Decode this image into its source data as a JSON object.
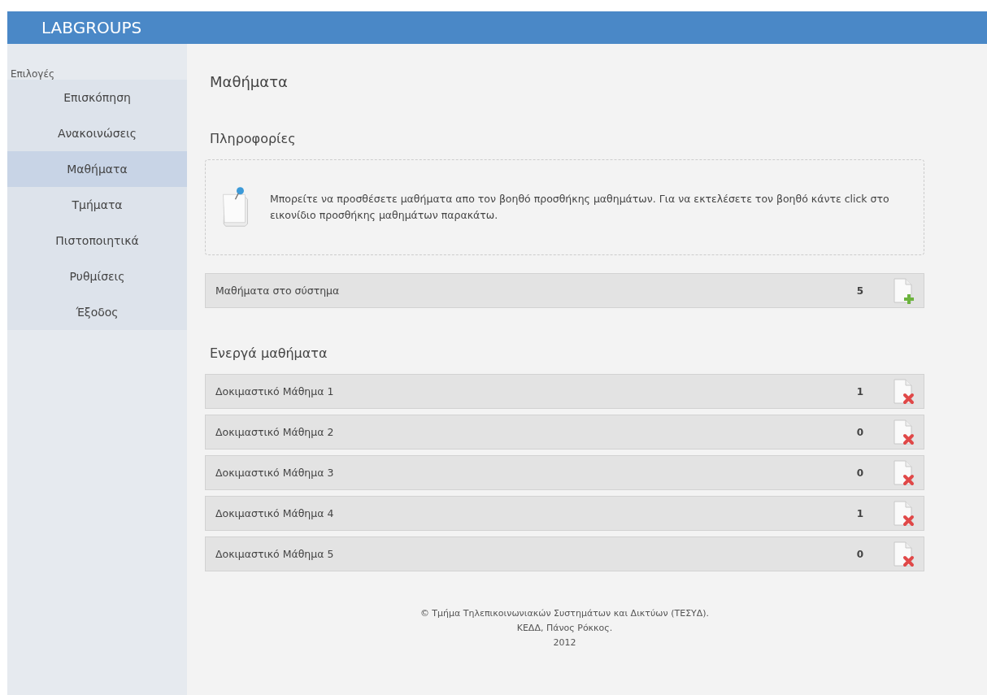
{
  "header": {
    "title": "LABGROUPS"
  },
  "sidebar": {
    "label": "Επιλογές",
    "items": [
      {
        "label": "Επισκόπηση",
        "selected": false
      },
      {
        "label": "Ανακοινώσεις",
        "selected": false
      },
      {
        "label": "Μαθήματα",
        "selected": true
      },
      {
        "label": "Τμήματα",
        "selected": false
      },
      {
        "label": "Πιστοποιητικά",
        "selected": false
      },
      {
        "label": "Ρυθμίσεις",
        "selected": false
      },
      {
        "label": "Έξοδος",
        "selected": false
      }
    ]
  },
  "page_title": "Μαθήματα",
  "info": {
    "heading": "Πληροφορίες",
    "text": "Μπορείτε να προσθέσετε μαθήματα απο τον βοηθό προσθήκης μαθημάτων. Για να εκτελέσετε τον βοηθό κάντε click στο εικονίδιο προσθήκης μαθημάτων παρακάτω."
  },
  "summary": {
    "label": "Μαθήματα στο σύστημα",
    "count": "5"
  },
  "active": {
    "heading": "Ενεργά μαθήματα",
    "courses": [
      {
        "name": "Δοκιμαστικό Μάθημα 1",
        "count": "1"
      },
      {
        "name": "Δοκιμαστικό Μάθημα 2",
        "count": "0"
      },
      {
        "name": "Δοκιμαστικό Μάθημα 3",
        "count": "0"
      },
      {
        "name": "Δοκιμαστικό Μάθημα 4",
        "count": "1"
      },
      {
        "name": "Δοκιμαστικό Μάθημα 5",
        "count": "0"
      }
    ]
  },
  "footer": [
    "© Τμήμα Τηλεπικοινωνιακών Συστημάτων και Δικτύων (ΤΕΣΥΔ).",
    "ΚΕΔΔ, Πάνος Ρόκκος.",
    "2012"
  ]
}
